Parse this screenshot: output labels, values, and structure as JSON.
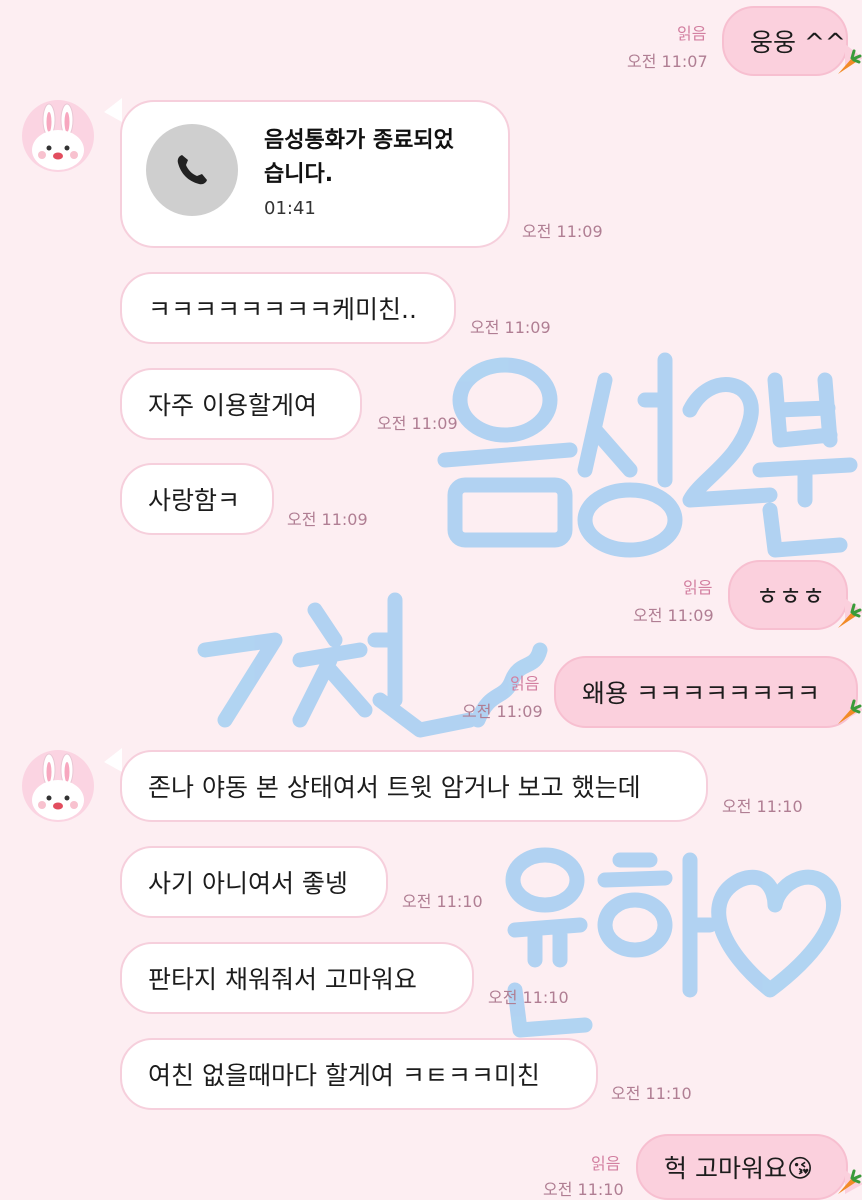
{
  "messages": {
    "m1": {
      "text": "웅웅 ^^",
      "read": "읽음",
      "time": "오전 11:07"
    },
    "call": {
      "title": "음성통화가 종료되었습니다.",
      "duration": "01:41",
      "time": "오전 11:09"
    },
    "m2": {
      "text": "ㅋㅋㅋㅋㅋㅋㅋㅋ케미친..",
      "time": "오전 11:09"
    },
    "m3": {
      "text": "자주 이용할게여",
      "time": "오전 11:09"
    },
    "m4": {
      "text": "사랑함ㅋ",
      "time": "오전 11:09"
    },
    "m5": {
      "text": "ㅎㅎㅎ",
      "read": "읽음",
      "time": "오전 11:09"
    },
    "m6": {
      "text": "왜용 ㅋㅋㅋㅋㅋㅋㅋㅋ",
      "read": "읽음",
      "time": "오전 11:09"
    },
    "m7": {
      "text": "존나 야동 본 상태여서 트윗 암거나 보고 했는데",
      "time": "오전 11:10"
    },
    "m8": {
      "text": "사기 아니여서 좋넹",
      "time": "오전 11:10"
    },
    "m9": {
      "text": "판타지 채워줘서 고마워요",
      "time": "오전 11:10"
    },
    "m10": {
      "text": "여친 없을때마다 할게여 ㅋㅌㅋㅋ미친",
      "time": "오전 11:10"
    },
    "m11": {
      "text": "헉 고마워요😘",
      "read": "읽음",
      "time": "오전 11:10"
    }
  },
  "icons": {
    "avatar": "bunny-avatar-icon",
    "phone": "phone-icon",
    "carrot": "carrot-icon"
  },
  "colors": {
    "background": "#fdeef2",
    "incoming_bubble": "#ffffff",
    "outgoing_bubble": "#fbd0dd",
    "handwriting": "#a9d0f2"
  }
}
